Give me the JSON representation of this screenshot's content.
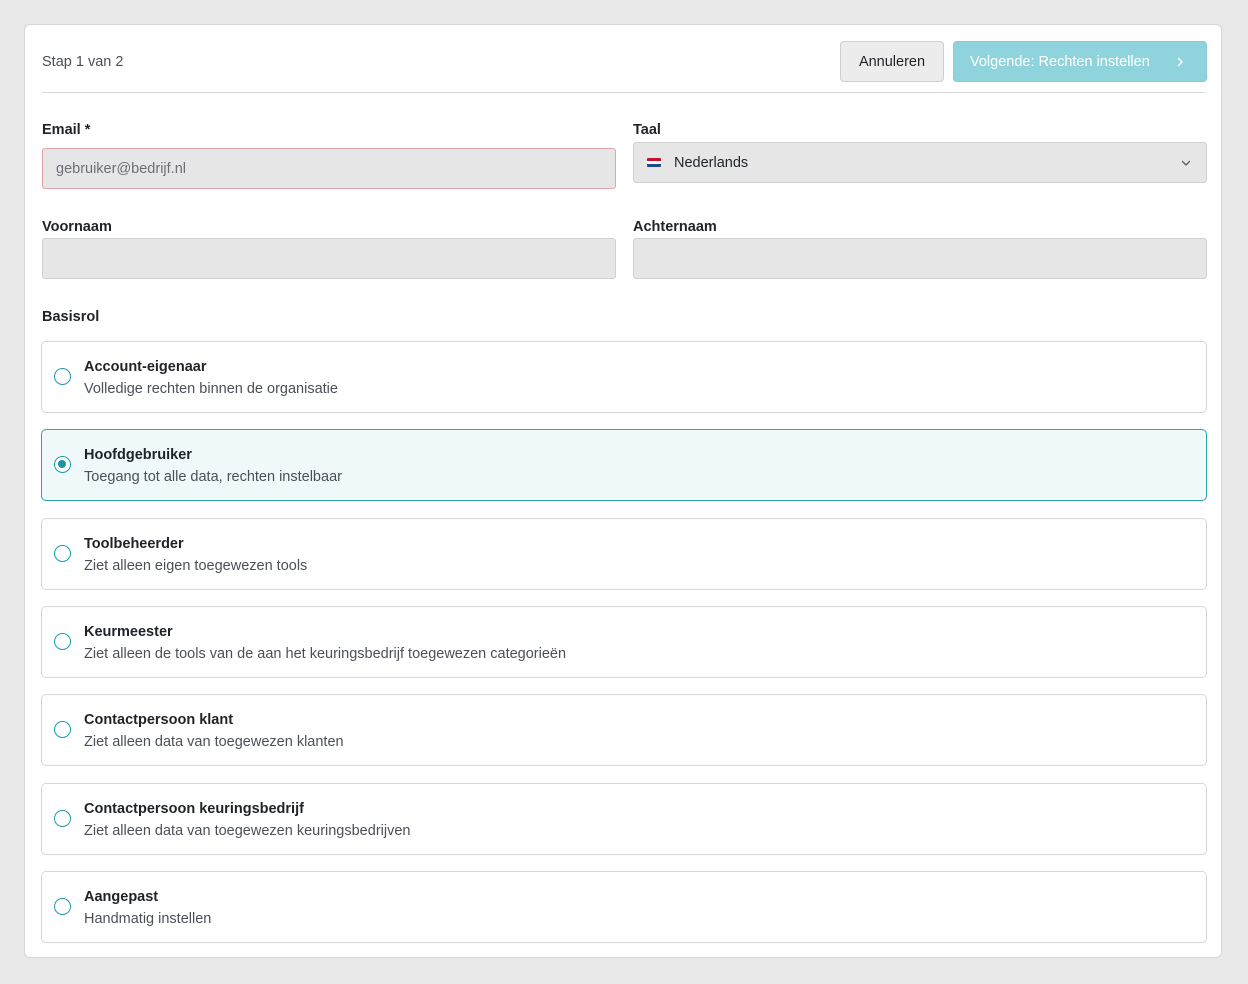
{
  "header": {
    "step_text": "Stap 1 van 2",
    "cancel_label": "Annuleren",
    "next_label": "Volgende: Rechten instellen"
  },
  "form": {
    "email": {
      "label": "Email *",
      "value": "",
      "placeholder": "gebruiker@bedrijf.nl"
    },
    "language": {
      "label": "Taal",
      "value": "Nederlands",
      "flag": "netherlands-flag-icon"
    },
    "first_name": {
      "label": "Voornaam",
      "value": ""
    },
    "last_name": {
      "label": "Achternaam",
      "value": ""
    },
    "role_label": "Basisrol"
  },
  "roles": [
    {
      "title": "Account-eigenaar",
      "description": "Volledige rechten binnen de organisatie",
      "selected": false
    },
    {
      "title": "Hoofdgebruiker",
      "description": "Toegang tot alle data, rechten instelbaar",
      "selected": true
    },
    {
      "title": "Toolbeheerder",
      "description": "Ziet alleen eigen toegewezen tools",
      "selected": false
    },
    {
      "title": "Keurmeester",
      "description": "Ziet alleen de tools van de aan het keuringsbedrijf toegewezen categorieën",
      "selected": false
    },
    {
      "title": "Contactpersoon klant",
      "description": "Ziet alleen data van toegewezen klanten",
      "selected": false
    },
    {
      "title": "Contactpersoon keuringsbedrijf",
      "description": "Ziet alleen data van toegewezen keuringsbedrijven",
      "selected": false
    },
    {
      "title": "Aangepast",
      "description": "Handmatig instellen",
      "selected": false
    }
  ],
  "colors": {
    "accent": "#1a95a8",
    "next_button_disabled": "#8fd4dc",
    "error_border": "#e2a4a8",
    "selected_background": "#eff9fa"
  }
}
